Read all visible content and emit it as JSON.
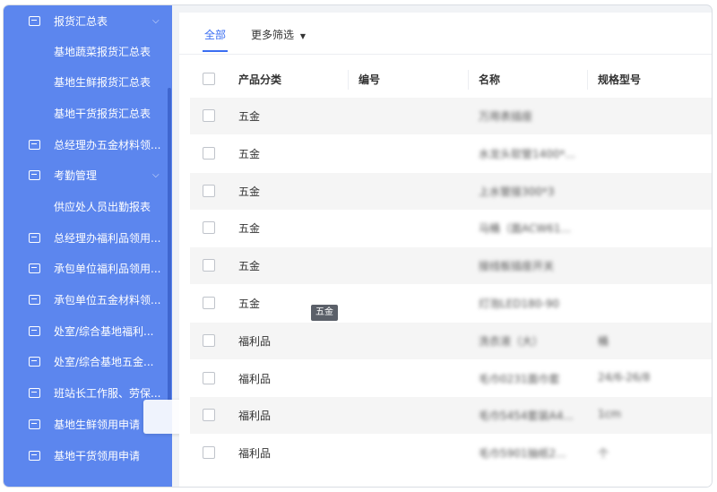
{
  "sidebar": {
    "items": [
      {
        "label": "报货汇总表",
        "icon": "folder-icon",
        "expandable": true
      },
      {
        "label": "基地蔬菜报货汇总表",
        "icon": "",
        "expandable": false
      },
      {
        "label": "基地生鲜报货汇总表",
        "icon": "",
        "expandable": false
      },
      {
        "label": "基地干货报货汇总表",
        "icon": "",
        "expandable": false
      },
      {
        "label": "总经理办五金材料领...",
        "icon": "folder-icon",
        "expandable": false
      },
      {
        "label": "考勤管理",
        "icon": "folder-icon",
        "expandable": true
      },
      {
        "label": "供应处人员出勤报表",
        "icon": "",
        "expandable": false
      },
      {
        "label": "总经理办福利品领用...",
        "icon": "folder-icon",
        "expandable": false
      },
      {
        "label": "承包单位福利品领用...",
        "icon": "folder-icon",
        "expandable": false
      },
      {
        "label": "承包单位五金材料领...",
        "icon": "folder-icon",
        "expandable": false
      },
      {
        "label": "处室/综合基地福利...",
        "icon": "folder-icon",
        "expandable": false
      },
      {
        "label": "处室/综合基地五金...",
        "icon": "folder-icon",
        "expandable": false
      },
      {
        "label": "班站长工作服、劳保...",
        "icon": "folder-icon",
        "expandable": false
      },
      {
        "label": "基地生鲜领用申请",
        "icon": "folder-icon",
        "expandable": false
      },
      {
        "label": "基地干货领用申请",
        "icon": "folder-icon",
        "expandable": false
      }
    ]
  },
  "tabs": {
    "all": "全部",
    "more_filters": "更多筛选",
    "more_filters_icon": "caret-down-icon"
  },
  "table": {
    "headers": {
      "category": "产品分类",
      "code": "编号",
      "name": "名称",
      "spec": "规格型号"
    },
    "rows": [
      {
        "category": "五金",
        "code": "",
        "name": "万用表插座",
        "spec": ""
      },
      {
        "category": "五金",
        "code": "",
        "name": "水龙头软管1400*...",
        "spec": ""
      },
      {
        "category": "五金",
        "code": "",
        "name": "上水管接300*3",
        "spec": ""
      },
      {
        "category": "五金",
        "code": "",
        "name": "马桶（面ACW61...",
        "spec": ""
      },
      {
        "category": "五金",
        "code": "",
        "name": "接线板插座开关",
        "spec": ""
      },
      {
        "category": "五金",
        "code": "",
        "name": "灯泡LED180-90",
        "spec": ""
      },
      {
        "category": "福利品",
        "code": "",
        "name": "洗衣液（大）",
        "spec": "桶"
      },
      {
        "category": "福利品",
        "code": "",
        "name": "毛巾0231面巾套",
        "spec": "24/6-26/8"
      },
      {
        "category": "福利品",
        "code": "",
        "name": "毛巾5454套装A4...",
        "spec": "1cm"
      },
      {
        "category": "福利品",
        "code": "",
        "name": "毛巾5901抽纸2...",
        "spec": "个"
      }
    ]
  },
  "tooltip": "五金"
}
